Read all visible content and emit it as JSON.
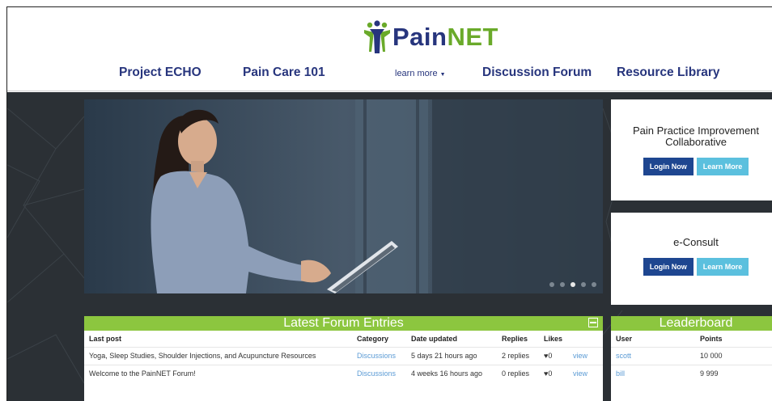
{
  "site": {
    "logo_pain": "Pain",
    "logo_net": "NET"
  },
  "nav": {
    "items": [
      {
        "label": "Project ECHO"
      },
      {
        "label": "Pain Care 101"
      },
      {
        "label": "learn more"
      },
      {
        "label": "Discussion Forum"
      },
      {
        "label": "Resource Library"
      }
    ]
  },
  "hero": {
    "slide_count": 5,
    "active_slide": 3
  },
  "panels": [
    {
      "title": "Pain Practice Improvement Collaborative",
      "login": "Login Now",
      "learn": "Learn More"
    },
    {
      "title": "e-Consult",
      "login": "Login Now",
      "learn": "Learn More"
    }
  ],
  "forum": {
    "title": "Latest Forum Entries",
    "columns": [
      "Last post",
      "Category",
      "Date updated",
      "Replies",
      "Likes"
    ],
    "rows": [
      {
        "post": "Yoga, Sleep Studies, Shoulder Injections, and Acupuncture Resources",
        "category": "Discussions",
        "date": "5 days 21 hours ago",
        "replies": "2 replies",
        "likes": "0",
        "action": "view"
      },
      {
        "post": "Welcome to the PainNET Forum!",
        "category": "Discussions",
        "date": "4 weeks 16 hours ago",
        "replies": "0 replies",
        "likes": "0",
        "action": "view"
      }
    ]
  },
  "leaderboard": {
    "title": "Leaderboard",
    "columns": [
      "User",
      "Points"
    ],
    "rows": [
      {
        "user": "scott",
        "points": "10 000"
      },
      {
        "user": "bill",
        "points": "9 999"
      }
    ]
  },
  "colors": {
    "brand_navy": "#27357d",
    "brand_green": "#6aaa2a",
    "bar_green": "#8cc63f",
    "login_blue": "#1e4690",
    "learn_blue": "#5bc0de"
  }
}
